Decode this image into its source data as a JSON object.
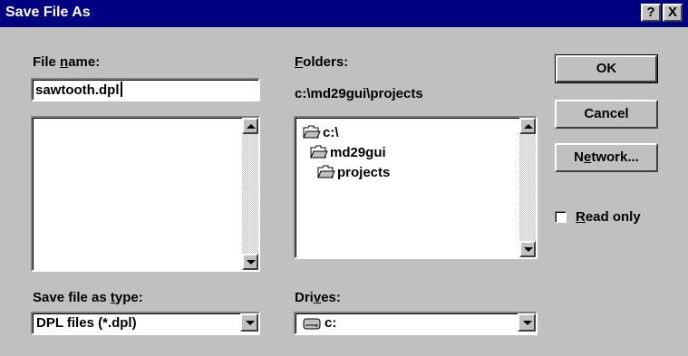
{
  "window": {
    "title": "Save File As",
    "help_button": "?",
    "close_button": "X"
  },
  "file_name": {
    "label_pre": "File ",
    "label_accel": "n",
    "label_post": "ame:",
    "value": "sawtooth.dpl",
    "files": []
  },
  "folders": {
    "label_accel": "F",
    "label_post": "olders:",
    "current_path": "c:\\md29gui\\projects",
    "items": [
      {
        "label": "c:\\",
        "icon": "open-folder-icon"
      },
      {
        "label": "md29gui",
        "icon": "open-folder-icon"
      },
      {
        "label": "projects",
        "icon": "open-folder-icon"
      }
    ]
  },
  "save_type": {
    "label_pre": "Save file as ",
    "label_accel": "t",
    "label_post": "ype:",
    "selected": "DPL files (*.dpl)"
  },
  "drives": {
    "label_pre": "Dri",
    "label_accel": "v",
    "label_post": "es:",
    "selected": "c:",
    "icon": "drive-icon"
  },
  "buttons": {
    "ok": "OK",
    "cancel": "Cancel",
    "network_pre": "N",
    "network_accel": "e",
    "network_post": "twork..."
  },
  "read_only": {
    "label_accel": "R",
    "label_post": "ead only",
    "checked": false
  },
  "colors": {
    "title_bar": "#000080",
    "dialog_face": "#c0c0c0",
    "field": "#ffffff"
  }
}
